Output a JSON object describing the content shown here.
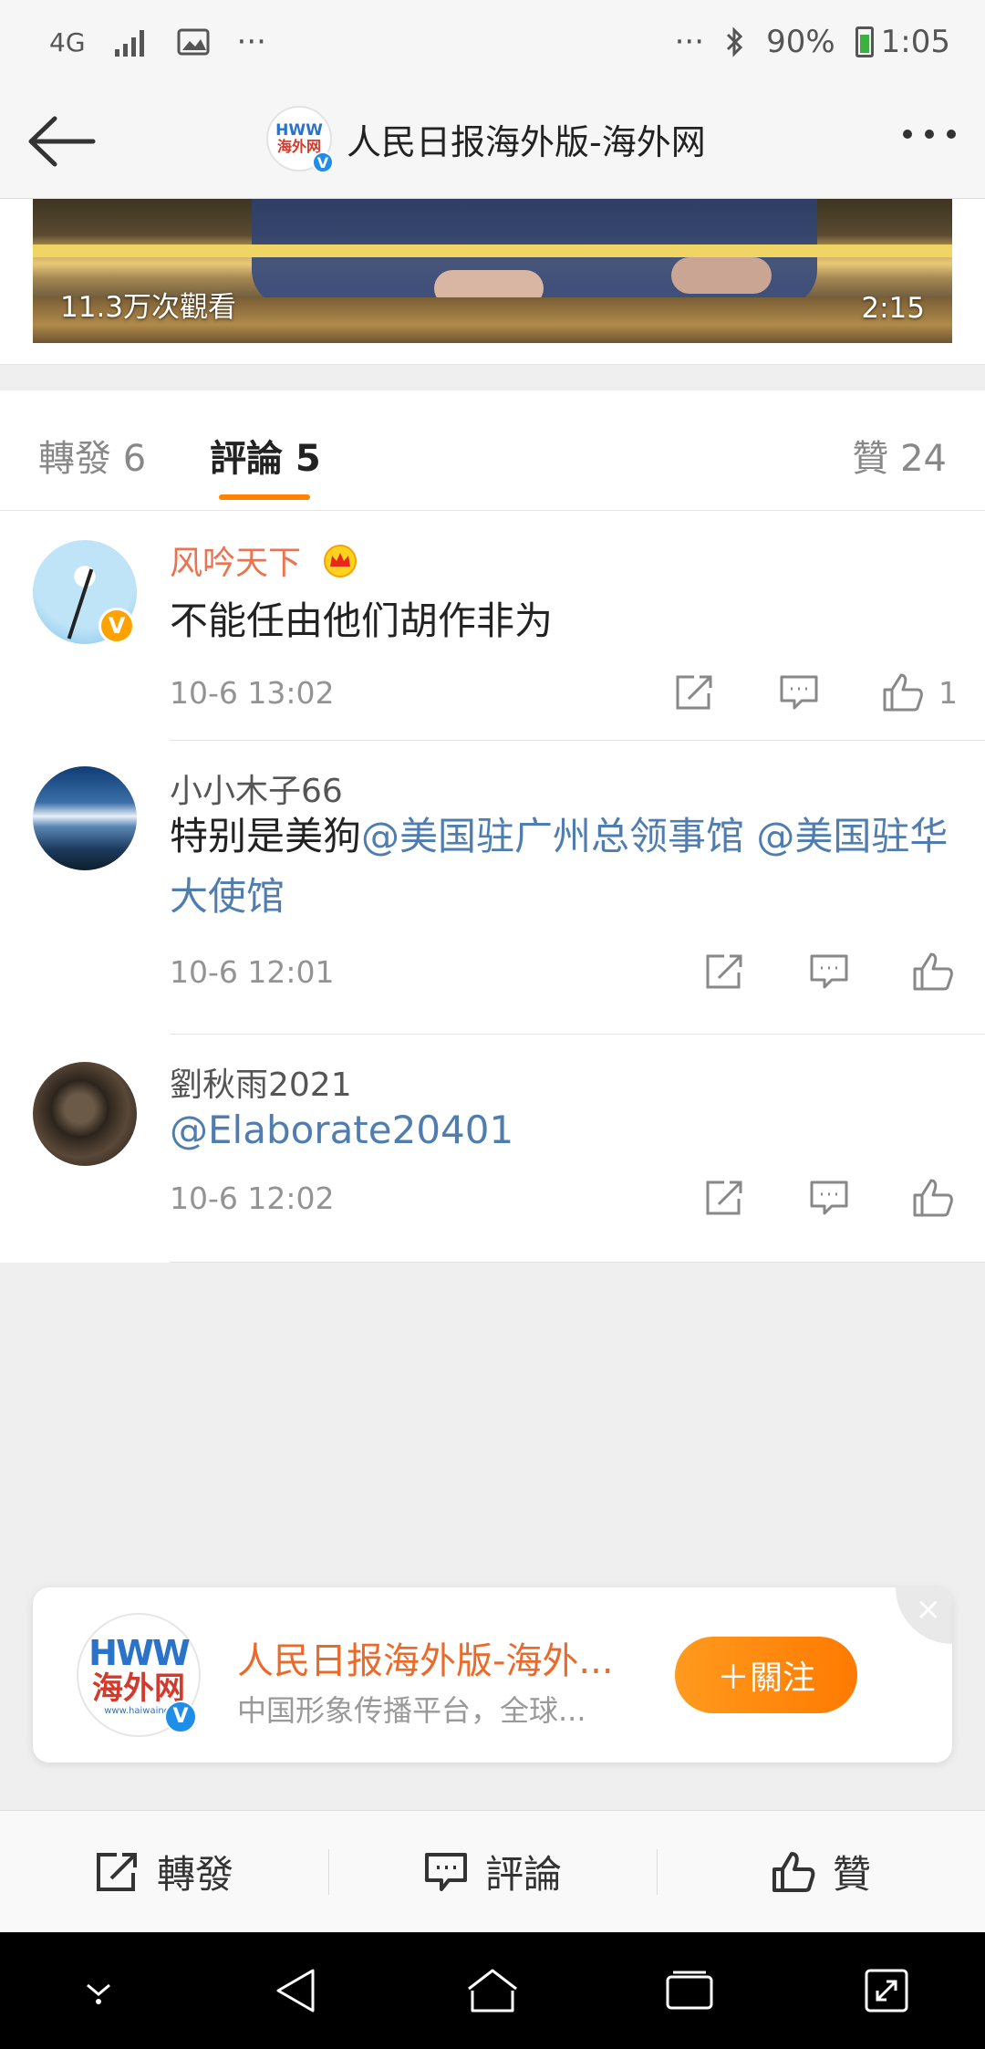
{
  "status_bar": {
    "network": "4G",
    "left_more": "···",
    "right_more": "···",
    "battery": "90%",
    "time": "1:05"
  },
  "header": {
    "title": "人民日报海外版-海外网",
    "logo_hw": "HWW",
    "logo_cn": "海外网",
    "verified": "V"
  },
  "video": {
    "views": "11.3万次觀看",
    "duration": "2:15"
  },
  "tabs": {
    "repost": "轉發 6",
    "comments": "評論 5",
    "likes": "贊 24"
  },
  "comments": [
    {
      "name": "风吟天下",
      "verified": "V",
      "text_plain": "不能任由他们胡作非为",
      "time": "10-6 13:02",
      "likes": "1"
    },
    {
      "name": "小小木子66",
      "text_plain": "特别是美狗",
      "mention1": "@美国驻广州总领事馆",
      "mention2": "@美国驻华大使馆",
      "time": "10-6 12:01"
    },
    {
      "name": "劉秋雨2021",
      "mention1": "@Elaborate20401",
      "time": "10-6 12:02"
    }
  ],
  "follow_card": {
    "logo_hw": "HWW",
    "logo_cn": "海外网",
    "logo_url": "www.haiwainet",
    "name": "人民日报海外版-海外...",
    "desc": "中国形象传播平台，全球...",
    "follow_label": "＋關注",
    "close": "×"
  },
  "bottom_bar": {
    "repost": "轉發",
    "comment": "評論",
    "like": "贊"
  },
  "colors": {
    "accent_orange": "#ff8200",
    "mention_blue": "#507daf",
    "vip_name": "#eb7350"
  }
}
